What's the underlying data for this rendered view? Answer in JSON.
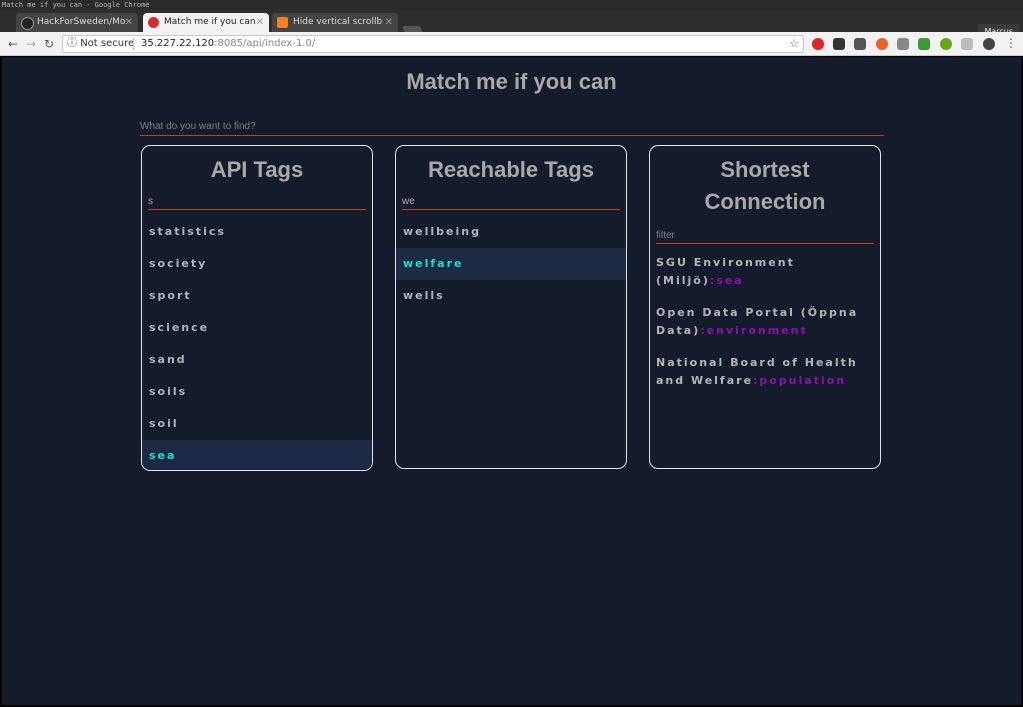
{
  "window": {
    "title": "Match me if you can - Google Chrome",
    "profile": "Marcus"
  },
  "tabs": [
    {
      "label": "HackForSweden/Mo",
      "icon": "github-icon"
    },
    {
      "label": "Match me if you can",
      "icon": "angular-icon",
      "active": true
    },
    {
      "label": "Hide vertical scrollb",
      "icon": "stackoverflow-icon"
    }
  ],
  "toolbar": {
    "security": "Not secure",
    "url_host": "35.227.22.120",
    "url_rest": ":8085/api/index-1.0/"
  },
  "app": {
    "title": "Match me if you can",
    "search_placeholder": "What do you want to find?"
  },
  "api_tags": {
    "title": "API Tags",
    "filter_value": "s",
    "items": [
      "statistics",
      "society",
      "sport",
      "science",
      "sand",
      "soils",
      "soil",
      "sea"
    ],
    "selected": "sea"
  },
  "reachable_tags": {
    "title": "Reachable Tags",
    "filter_value": "we",
    "items": [
      "wellbeing",
      "welfare",
      "wells"
    ],
    "selected": "welfare"
  },
  "shortest_connection": {
    "title": "Shortest Connection",
    "filter_placeholder": "filter",
    "items": [
      {
        "name": "SGU Environment (Miljö)",
        "tag": ":sea"
      },
      {
        "name": "Open Data Portal (Öppna Data)",
        "tag": ":environment"
      },
      {
        "name": "National Board of Health and Welfare",
        "tag": ":population"
      }
    ]
  },
  "colors": {
    "page_bg": "#141b2a",
    "accent_underline": "#c0441a",
    "selected_text": "#22e0c4",
    "selected_bg": "#1c2a46",
    "connection_tag": "#8b12a8"
  }
}
